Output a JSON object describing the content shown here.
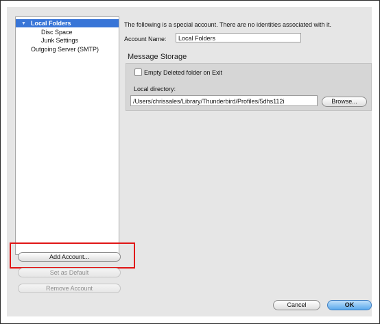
{
  "sidebar": {
    "items": [
      {
        "label": "Local Folders",
        "selected": true
      },
      {
        "label": "Disc Space"
      },
      {
        "label": "Junk Settings"
      },
      {
        "label": "Outgoing Server (SMTP)"
      }
    ]
  },
  "account": {
    "notice": "The following is a special account. There are no identities associated with it.",
    "name_label": "Account Name:",
    "name_value": "Local Folders"
  },
  "message_storage": {
    "title": "Message Storage",
    "empty_deleted_label": "Empty Deleted folder on Exit",
    "empty_deleted_checked": false,
    "local_directory_label": "Local directory:",
    "local_directory_value": "/Users/chrissales/Library/Thunderbird/Profiles/5dhs112i",
    "browse_label": "Browse..."
  },
  "actions": {
    "add_account": "Add Account...",
    "set_default": "Set as Default",
    "remove_account": "Remove Account"
  },
  "dialog": {
    "cancel": "Cancel",
    "ok": "OK"
  },
  "colors": {
    "selection": "#3875d7",
    "highlight_box": "#e01414",
    "default_button": "#5aa9ec"
  }
}
